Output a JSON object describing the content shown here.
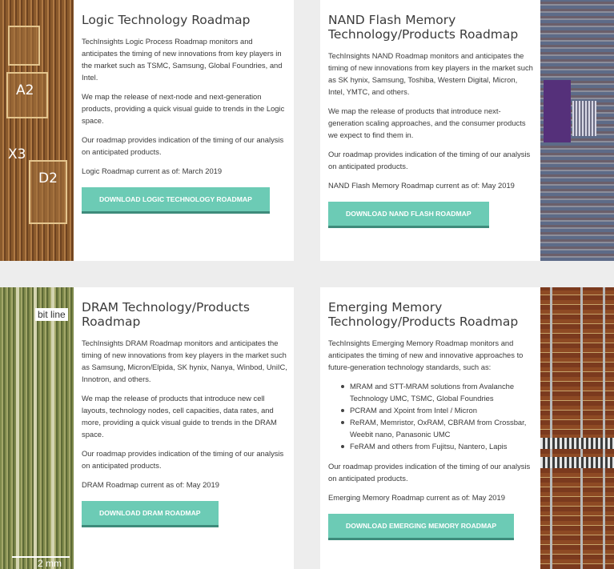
{
  "cards": [
    {
      "title": "Logic Technology Roadmap",
      "paragraphs": [
        "TechInsights Logic Process Roadmap monitors and anticipates the timing of new innovations from key players in the market such as TSMC, Samsung, Global Foundries, and Intel.",
        "We map the release of next-node and next-generation products, providing a quick visual guide to trends in the Logic space.",
        "Our roadmap provides indication of the timing of our analysis on anticipated products.",
        "Logic Roadmap current as of: March 2019"
      ],
      "button": "DOWNLOAD LOGIC TECHNOLOGY ROADMAP",
      "image_labels": [
        "A2",
        "X3",
        "D2"
      ]
    },
    {
      "title": "NAND Flash Memory Technology/Products Roadmap",
      "paragraphs": [
        "TechInsights NAND Roadmap monitors and anticipates the timing of new innovations from key players in the market such as SK hynix, Samsung, Toshiba, Western Digital, Micron, Intel, YMTC, and others.",
        "We map the release of products that introduce next-generation scaling approaches, and the consumer products we expect to find them in.",
        "Our roadmap provides indication of the timing of our analysis on anticipated products.",
        "NAND Flash Memory Roadmap current as of: May 2019"
      ],
      "button": "DOWNLOAD NAND FLASH ROADMAP"
    },
    {
      "title": "DRAM Technology/Products Roadmap",
      "paragraphs": [
        "TechInsights DRAM Roadmap monitors and anticipates the timing of new innovations from key players in the market such as Samsung, Micron/Elpida, SK hynix, Nanya, Winbod, UniIC, Innotron, and others.",
        "We map the release of products that introduce new cell layouts, technology nodes, cell capacities, data rates, and more, providing a quick visual guide to trends in the DRAM space.",
        "Our roadmap provides indication of the timing of our analysis on anticipated products.",
        "DRAM Roadmap current as of: May 2019"
      ],
      "button": "DOWNLOAD DRAM ROADMAP",
      "image_labels": [
        "bit line",
        "2 mm"
      ]
    },
    {
      "title": "Emerging Memory Technology/Products Roadmap",
      "intro": "TechInsights Emerging Memory Roadmap monitors and anticipates the timing of new and innovative approaches to future-generation technology standards, such as:",
      "bullets": [
        "MRAM and STT-MRAM solutions from Avalanche Technology UMC, TSMC, Global Foundries",
        "PCRAM and Xpoint from Intel / Micron",
        "ReRAM, Memristor, OxRAM, CBRAM from Crossbar, Weebit nano, Panasonic UMC",
        "FeRAM and others from Fujitsu, Nantero, Lapis"
      ],
      "paragraphs": [
        "Our roadmap provides indication of the timing of our analysis on anticipated products.",
        "Emerging Memory Roadmap current as of: May 2019"
      ],
      "button": "DOWNLOAD EMERGING MEMORY ROADMAP"
    }
  ]
}
